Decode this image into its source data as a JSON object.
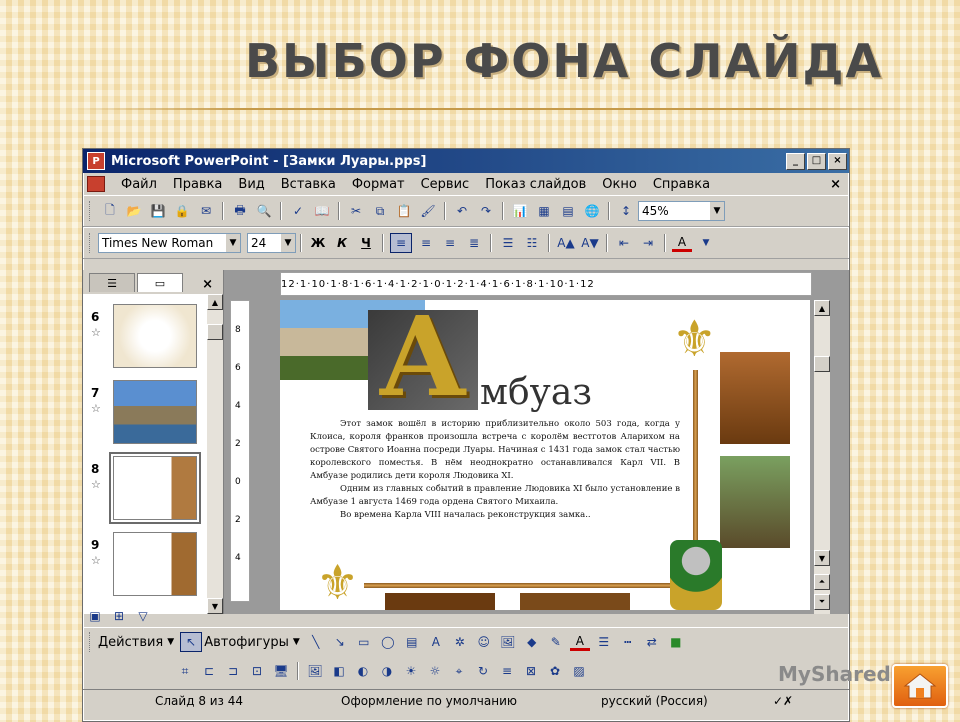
{
  "slide_title": "ВЫБОР ФОНА СЛАЙДА",
  "window": {
    "title": "Microsoft PowerPoint - [Замки Луары.pps]",
    "buttons": [
      "_",
      "□",
      "×"
    ]
  },
  "menu": [
    "Файл",
    "Правка",
    "Вид",
    "Вставка",
    "Формат",
    "Сервис",
    "Показ слайдов",
    "Окно",
    "Справка"
  ],
  "menu_close": "×",
  "standard_toolbar": {
    "zoom": "45%"
  },
  "format_toolbar": {
    "font": "Times New Roman",
    "size": "24",
    "bold": "Ж",
    "italic": "К",
    "underline": "Ч"
  },
  "outline_pane": {
    "close": "×",
    "thumbnails": [
      {
        "num": "6"
      },
      {
        "num": "7"
      },
      {
        "num": "8",
        "selected": true
      },
      {
        "num": "9"
      }
    ]
  },
  "ruler_h": "12·1·10·1·8·1·6·1·4·1·2·1·0·1·2·1·4·1·6·1·8·1·10·1·12",
  "ruler_v": [
    "8",
    "6",
    "4",
    "2",
    "0",
    "2",
    "4"
  ],
  "slide": {
    "heading_letter": "А",
    "heading_rest": "мбуаз",
    "paragraphs": [
      "Этот замок вошёл в историю приблизительно около 503 года, когда у Клоиса, короля франков произошла встреча с королём вестготов Аларихом на острове Святого Иоанна посреди Луары. Начиная с 1431 года замок стал частью королевского поместья. В нём неоднократно останавливался Карл VII. В Амбуазе родились дети короля Людовика XI.",
      "Одним из главных событий в правление Людовика XI было установление в Амбуазе 1 августа 1469 года ордена Святого Михаила.",
      "Во времена Карла VIII началась реконструкция замка.."
    ]
  },
  "drawing_toolbar": {
    "actions": "Действия",
    "autoshapes": "Автофигуры"
  },
  "status": {
    "slide": "Слайд 8 из 44",
    "design": "Оформление по умолчанию",
    "language": "русский (Россия)"
  },
  "watermark": "MyShared",
  "colors": {
    "titlebar_start": "#0a246a",
    "titlebar_end": "#3a6ea5",
    "home_button": "#f08020"
  }
}
